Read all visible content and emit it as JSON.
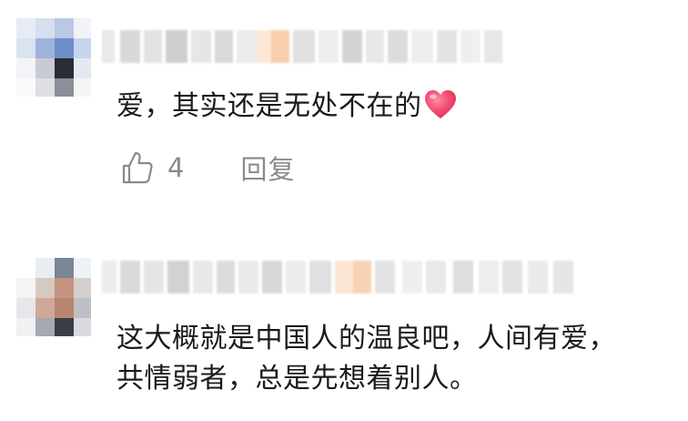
{
  "comments": [
    {
      "text": "爱，其实还是无处不在的",
      "emoji": "heart-emoji",
      "likes": "4",
      "reply_label": "回复",
      "name_redacted": true,
      "avatar_redacted": true
    },
    {
      "lines": [
        "这大概就是中国人的温良吧，人间有爱，",
        "共情弱者，总是先想着别人。"
      ],
      "name_redacted": true,
      "avatar_redacted": true
    }
  ],
  "colors": {
    "text": "#1a1a1a",
    "meta": "#8a8a8a",
    "heart": "#f0486d",
    "background": "#ffffff"
  }
}
